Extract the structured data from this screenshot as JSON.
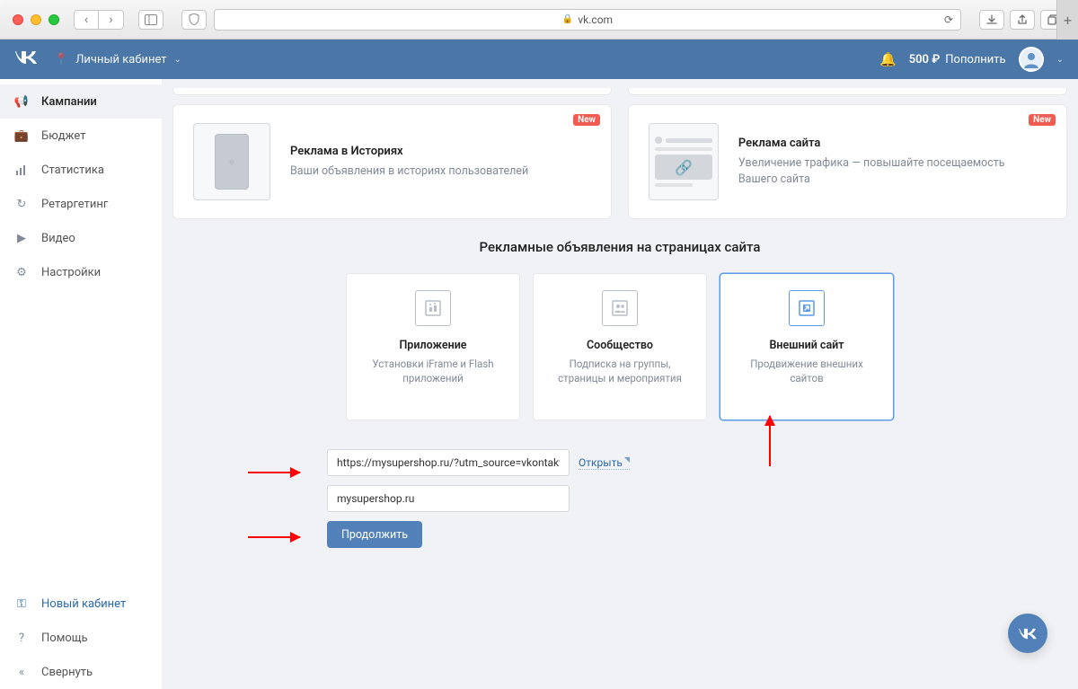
{
  "browser": {
    "address": "vk.com"
  },
  "header": {
    "nav_label": "Личный кабинет",
    "balance": "500 ₽",
    "topup": "Пополнить"
  },
  "sidebar": {
    "items": [
      {
        "label": "Кампании"
      },
      {
        "label": "Бюджет"
      },
      {
        "label": "Статистика"
      },
      {
        "label": "Ретаргетинг"
      },
      {
        "label": "Видео"
      },
      {
        "label": "Настройки"
      }
    ],
    "footer": [
      {
        "label": "Новый кабинет"
      },
      {
        "label": "Помощь"
      },
      {
        "label": "Свернуть"
      }
    ]
  },
  "top_cards": {
    "story": {
      "badge": "New",
      "title": "Реклама в Историях",
      "sub": "Ваши объявления в историях пользователей"
    },
    "site": {
      "badge": "New",
      "title": "Реклама сайта",
      "sub": "Увеличение трафика — повышайте посещаемость Вашего сайта"
    }
  },
  "section_title": "Рекламные объявления на страницах сайта",
  "options": {
    "app": {
      "title": "Приложение",
      "sub": "Установки iFrame и Flash приложений"
    },
    "group": {
      "title": "Сообщество",
      "sub": "Подписка на группы, страницы и мероприятия"
    },
    "ext": {
      "title": "Внешний сайт",
      "sub": "Продвижение внешних сайтов"
    }
  },
  "form": {
    "url_value": "https://mysupershop.ru/?utm_source=vkontakte&ut",
    "open_label": "Открыть",
    "domain_value": "mysupershop.ru",
    "continue_label": "Продолжить"
  }
}
